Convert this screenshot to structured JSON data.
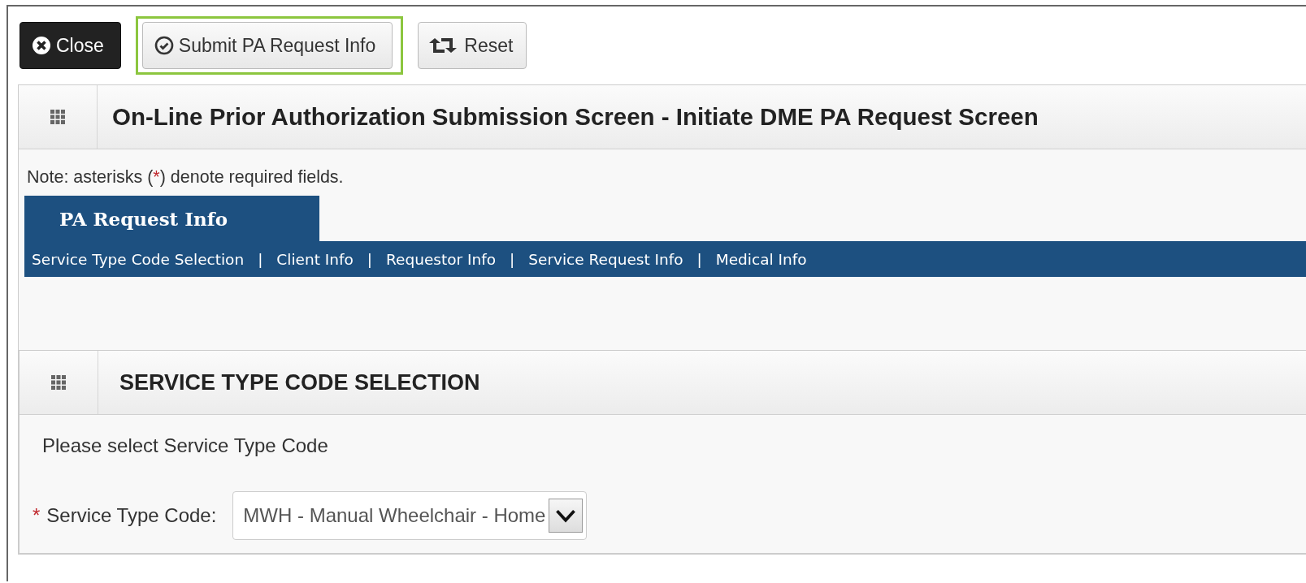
{
  "toolbar": [
    {
      "kind": "close",
      "label": "Close",
      "highlighted": false
    },
    {
      "kind": "submit",
      "label": "Submit PA Request Info",
      "highlighted": true
    },
    {
      "kind": "reset",
      "label": "Reset",
      "highlighted": false
    }
  ],
  "panel": {
    "title": "On-Line Prior Authorization Submission Screen - Initiate DME PA Request Screen"
  },
  "note": {
    "before": "Note: asterisks (",
    "mark": "*",
    "after": ") denote required fields."
  },
  "tabs": [
    {
      "label": "PA Request Info",
      "selected": true
    }
  ],
  "nav": {
    "separator": "|",
    "links": [
      "Service Type Code Selection",
      "Client Info",
      "Requestor Info",
      "Service Request Info",
      "Medical Info"
    ]
  },
  "section": {
    "title": "SERVICE TYPE CODE SELECTION",
    "instruction": "Please select Service Type Code",
    "field": {
      "required_mark": "*",
      "label": "Service Type Code:",
      "value": "MWH - Manual Wheelchair - Home"
    }
  }
}
